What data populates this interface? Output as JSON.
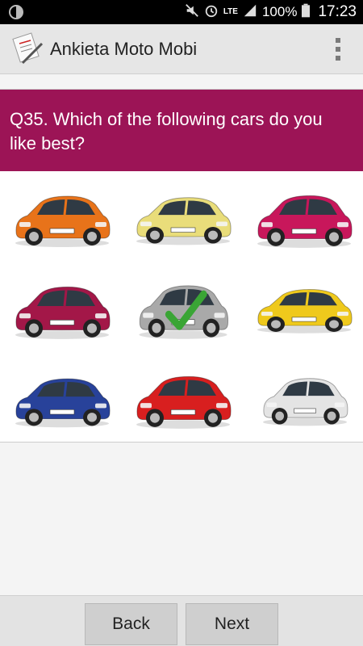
{
  "status_bar": {
    "battery": "100%",
    "time": "17:23",
    "network": "LTE"
  },
  "app": {
    "title": "Ankieta Moto Mobi"
  },
  "question": {
    "text": "Q35. Which of the following cars do you like best?"
  },
  "options": [
    {
      "name": "orange hatchback",
      "color": "#e8731a",
      "selected": false
    },
    {
      "name": "yellow hatchback",
      "color": "#e9dd7a",
      "selected": false
    },
    {
      "name": "magenta hatchback",
      "color": "#c8175b",
      "selected": false
    },
    {
      "name": "purple hatchback",
      "color": "#a31748",
      "selected": false
    },
    {
      "name": "silver hatchback",
      "color": "#a9a9a9",
      "selected": true
    },
    {
      "name": "yellow sport hatchback",
      "color": "#efc91c",
      "selected": false
    },
    {
      "name": "blue hatchback",
      "color": "#28429a",
      "selected": false
    },
    {
      "name": "red hatchback",
      "color": "#d81f1f",
      "selected": false
    },
    {
      "name": "white hatchback",
      "color": "#e4e4e4",
      "selected": false
    }
  ],
  "navigation": {
    "back_label": "Back",
    "next_label": "Next"
  },
  "colors": {
    "question_bg": "#9c1456",
    "check": "#3aa535"
  }
}
